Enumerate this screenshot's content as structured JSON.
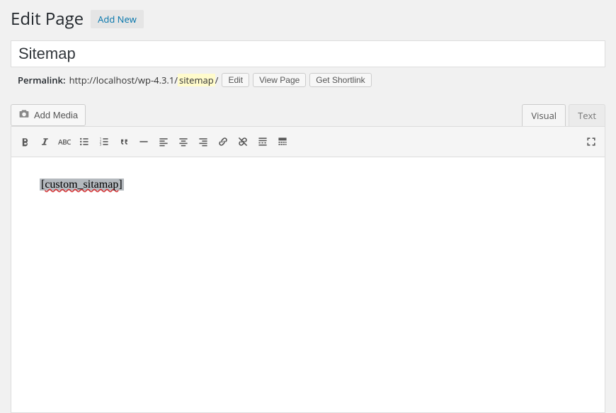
{
  "header": {
    "title": "Edit Page",
    "add_new": "Add New"
  },
  "post": {
    "title_value": "Sitemap"
  },
  "permalink": {
    "label": "Permalink:",
    "url_prefix": "http://localhost/wp-4.3.1/",
    "slug": "sitemap",
    "url_suffix": "/",
    "edit": "Edit",
    "view": "View Page",
    "shortlink": "Get Shortlink"
  },
  "media": {
    "add_media": "Add Media"
  },
  "tabs": {
    "visual": "Visual",
    "text": "Text"
  },
  "toolbar_icons": [
    "bold",
    "italic",
    "strikethrough",
    "bullist",
    "numlist",
    "blockquote",
    "hr",
    "alignleft",
    "aligncenter",
    "alignright",
    "link",
    "unlink",
    "more",
    "toolbar-toggle"
  ],
  "editor_content": {
    "shortcode_open": "[",
    "shortcode_text": "custom_sitamap",
    "shortcode_close": "]"
  }
}
